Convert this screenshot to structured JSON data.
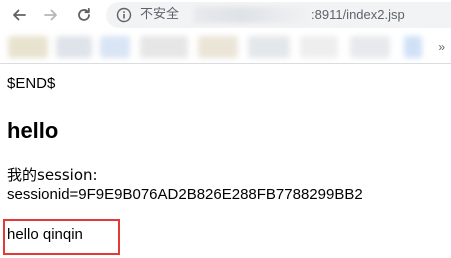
{
  "browser": {
    "security_label": "不安全",
    "url": ":8911/index2.jsp",
    "colors": {
      "omnibox_bg": "#f1f3f4",
      "icon": "#5f6368"
    }
  },
  "page": {
    "end_marker": "$END$",
    "heading": "hello",
    "session_label": "我的session:",
    "session_id": "sessionid=9F9E9B076AD2B826E288FB7788299BB2",
    "greeting": "hello qinqin",
    "highlight_color": "#e53935"
  }
}
